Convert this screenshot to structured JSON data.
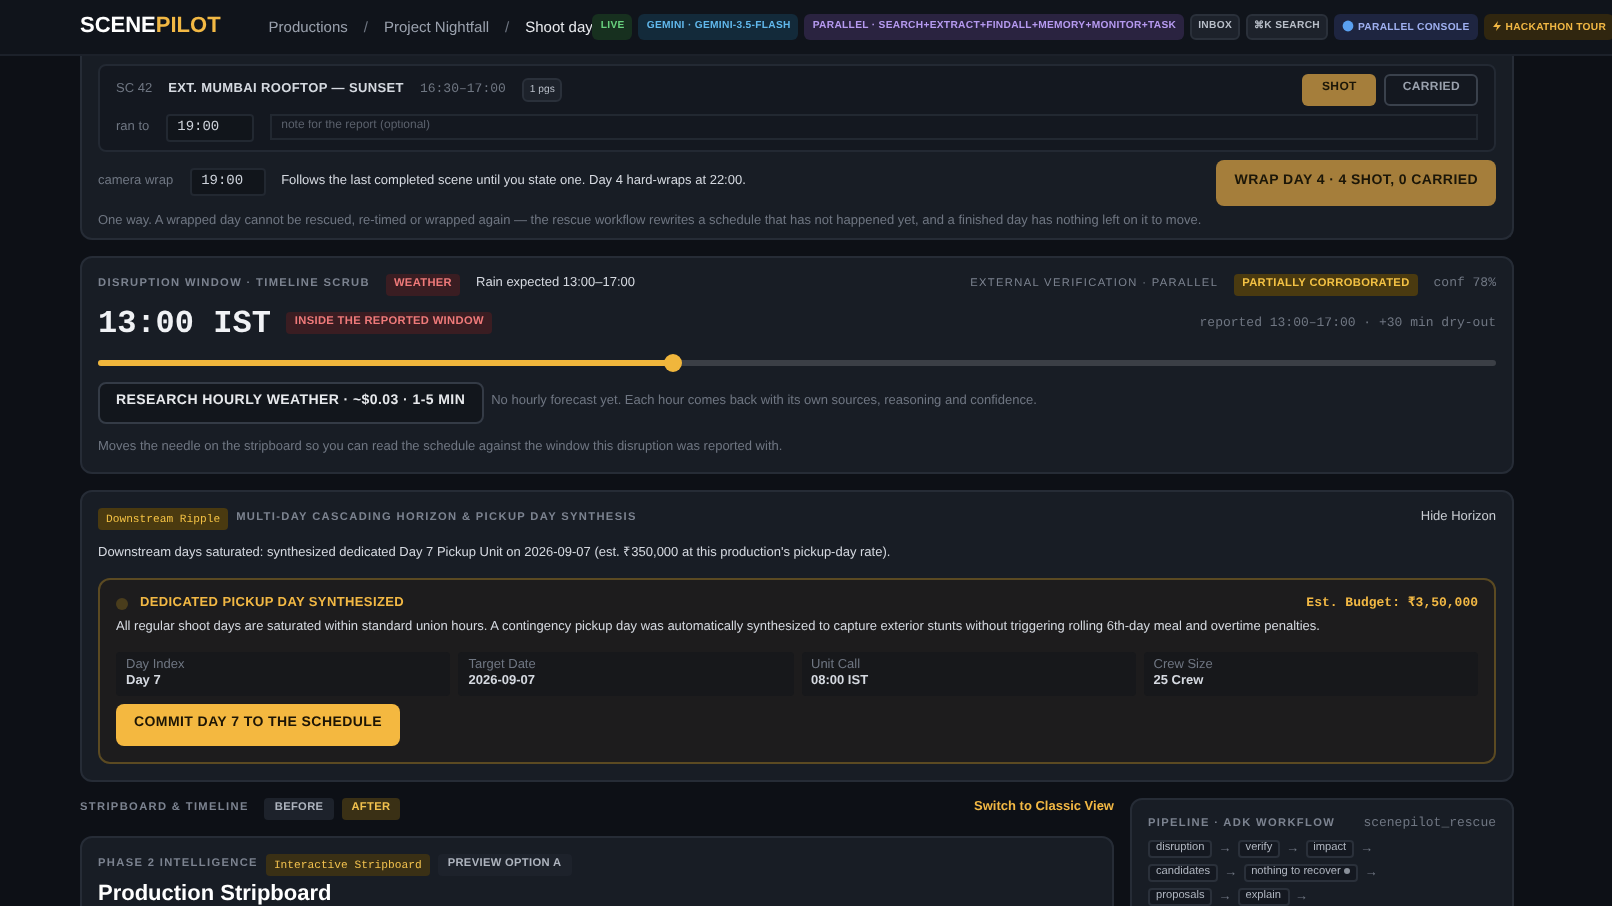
{
  "header": {
    "logo": {
      "first": "SCENE",
      "second": "PILOT"
    },
    "breadcrumbs": [
      {
        "label": "Productions",
        "kind": "link",
        "current": false
      },
      {
        "label": "/",
        "kind": "separator"
      },
      {
        "label": "Project Nightfall",
        "kind": "link",
        "current": false
      },
      {
        "label": "/",
        "kind": "separator"
      },
      {
        "label": "Shoot day",
        "kind": "link",
        "current": true
      }
    ],
    "chips": [
      {
        "label": "LIVE",
        "kind": "live"
      },
      {
        "label": "GEMINI · GEMINI-3.5-FLASH",
        "kind": "model"
      },
      {
        "label": "PARALLEL · SEARCH+EXTRACT+FINDALL+MEMORY+MONITOR+TASK",
        "kind": "parallel"
      },
      {
        "label": "INBOX",
        "kind": "plain"
      },
      {
        "label": "⌘K SEARCH",
        "kind": "plain"
      },
      {
        "label": "PARALLEL CONSOLE",
        "kind": "console"
      },
      {
        "label": "HACKATHON TOUR",
        "kind": "tour"
      }
    ]
  },
  "scene_log": {
    "scene": "SC 42",
    "heading": "EXT. MUMBAI ROOFTOP — SUNSET",
    "time": "16:30–17:00",
    "pages": "1 pgs",
    "buttons": [
      {
        "label": "SHOT",
        "kind": "primary"
      },
      {
        "label": "CARRIED",
        "kind": "outline"
      }
    ],
    "ran_to": {
      "label": "ran to",
      "value": "19:00",
      "placeholder": "note for the report (optional)"
    }
  },
  "wrap": {
    "label": "camera wrap",
    "value": "19:00",
    "hint": "Follows the last completed scene until you state one. Day 4 hard-wraps at 22:00.",
    "button": "WRAP DAY 4 · 4 SHOT, 0 CARRIED",
    "footnote": "One way. A wrapped day cannot be rescued, re-timed or wrapped again — the rescue workflow rewrites a schedule that has not happened yet, and a finished day has nothing left on it to move."
  },
  "disruption": {
    "title": "DISRUPTION WINDOW · TIMELINE SCRUB",
    "tag": "WEATHER",
    "description": "Rain expected 13:00–17:00",
    "verification": "EXTERNAL VERIFICATION · PARALLEL",
    "status": "PARTIALLY CORROBORATED",
    "confidence": "conf 78%",
    "time": "13:00 IST",
    "window_badge": "INSIDE THE REPORTED WINDOW",
    "reported": "reported 13:00–17:00 · +30 min dry-out",
    "level": 0.41,
    "research_button": "RESEARCH HOURLY WEATHER · ~$0.03 · 1-5 MIN",
    "research_note": "No hourly forecast yet. Each hour comes back with its own sources, reasoning and confidence.",
    "footnote": "Moves the needle on the stripboard so you can read the schedule against the window this disruption was reported with."
  },
  "downstream": {
    "tag": "Downstream Ripple",
    "title": "MULTI-DAY CASCADING HORIZON & PICKUP DAY SYNTHESIS",
    "toggle": "Hide Horizon",
    "summary": "Downstream days saturated: synthesized dedicated Day 7 Pickup Unit on 2026-09-07 (est. ₹350,000 at this production's pickup-day rate).",
    "pickup": {
      "title": "DEDICATED PICKUP DAY SYNTHESIZED",
      "budget": "Est. Budget: ₹3,50,000",
      "description": "All regular shoot days are saturated within standard union hours. A contingency pickup day was automatically synthesized to capture exterior stunts without triggering rolling 6th-day meal and overtime penalties.",
      "fields": [
        {
          "label": "Day Index",
          "value": "Day 7"
        },
        {
          "label": "Target Date",
          "value": "2026-09-07"
        },
        {
          "label": "Unit Call",
          "value": "08:00 IST"
        },
        {
          "label": "Crew Size",
          "value": "25 Crew"
        }
      ],
      "button": "COMMIT DAY 7 TO THE SCHEDULE"
    }
  },
  "stripboard": {
    "label": "STRIPBOARD & TIMELINE",
    "toggles": [
      {
        "label": "BEFORE",
        "selected": false
      },
      {
        "label": "AFTER",
        "selected": true
      }
    ],
    "switch_link": "Switch to Classic View",
    "panel": {
      "phase": "PHASE 2 INTELLIGENCE",
      "tag": "Interactive Stripboard",
      "preview": "PREVIEW OPTION A",
      "heading": "Production Stripboard"
    }
  },
  "pipeline": {
    "title": "PIPELINE · ADK WORKFLOW",
    "id": "scenepilot_rescue",
    "steps": [
      {
        "label": "disruption",
        "kind": "step",
        "arrow": "→"
      },
      {
        "label": "verify",
        "kind": "step",
        "arrow": "→"
      },
      {
        "label": "impact",
        "kind": "step",
        "arrow": "→"
      },
      {
        "label": "candidates",
        "kind": "step",
        "arrow": "→"
      },
      {
        "label": "nothing to recover",
        "kind": "skipped",
        "arrow": "→"
      },
      {
        "label": "proposals",
        "kind": "step",
        "arrow": "→"
      },
      {
        "label": "explain",
        "kind": "step",
        "arrow": "→"
      }
    ]
  }
}
